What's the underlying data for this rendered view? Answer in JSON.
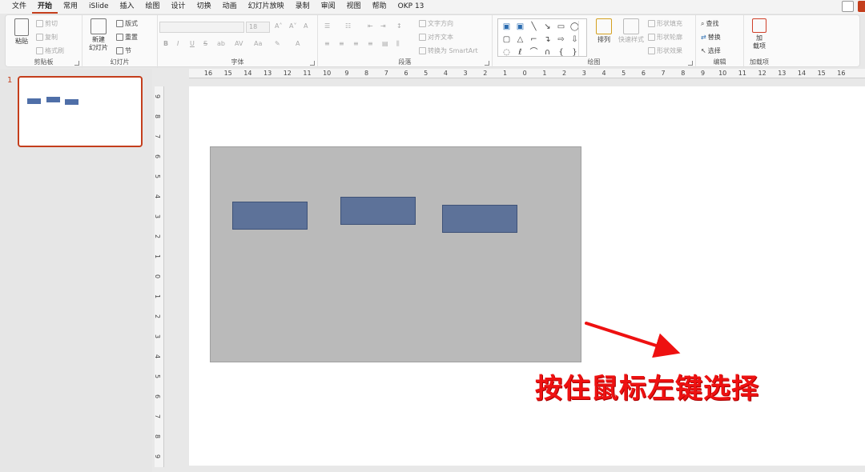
{
  "menu": {
    "items": [
      "文件",
      "开始",
      "常用",
      "iSlide",
      "插入",
      "绘图",
      "设计",
      "切换",
      "动画",
      "幻灯片放映",
      "录制",
      "审阅",
      "视图",
      "帮助",
      "OKP 13"
    ],
    "active": "开始"
  },
  "ribbon": {
    "clipboard": {
      "paste": "粘贴",
      "cut": "剪切",
      "copy": "复制",
      "format_painter": "格式刷",
      "label": "剪贴板"
    },
    "slides": {
      "new_slide_1": "新建",
      "new_slide_2": "幻灯片",
      "layout": "版式",
      "reset": "重置",
      "section": "节",
      "label": "幻灯片"
    },
    "font": {
      "size_value": "18",
      "bold": "B",
      "italic": "I",
      "underline": "U",
      "strike": "S",
      "shadow": "ab",
      "label": "字体"
    },
    "paragraph": {
      "text_direction": "文字方向",
      "align_text": "对齐文本",
      "smartart": "转换为 SmartArt",
      "label": "段落"
    },
    "drawing": {
      "arrange": "排列",
      "quick_styles": "快速样式",
      "shape_fill": "形状填充",
      "shape_outline": "形状轮廓",
      "shape_effects": "形状效果",
      "label": "绘图"
    },
    "editing": {
      "find": "查找",
      "replace": "替换",
      "select": "选择",
      "label": "编辑"
    },
    "addins": {
      "line1": "加",
      "line2": "载项",
      "label": "加载项"
    }
  },
  "thumbnails": {
    "slide_number": "1"
  },
  "rulers": {
    "horizontal": [
      "16",
      "15",
      "14",
      "13",
      "12",
      "11",
      "10",
      "9",
      "8",
      "7",
      "6",
      "5",
      "4",
      "3",
      "2",
      "1",
      "0",
      "1",
      "2",
      "3",
      "4",
      "5",
      "6",
      "7",
      "8",
      "9",
      "10",
      "11",
      "12",
      "13",
      "14",
      "15",
      "16"
    ],
    "vertical": [
      "9",
      "8",
      "7",
      "6",
      "5",
      "4",
      "3",
      "2",
      "1",
      "0",
      "1",
      "2",
      "3",
      "4",
      "5",
      "6",
      "7",
      "8",
      "9"
    ]
  },
  "annotation": {
    "text": "按住鼠标左键选择",
    "color": "#ee1111"
  },
  "colors": {
    "accent": "#c43e1c",
    "shape_fill": "#5d7299",
    "background_rect": "#bababa"
  }
}
